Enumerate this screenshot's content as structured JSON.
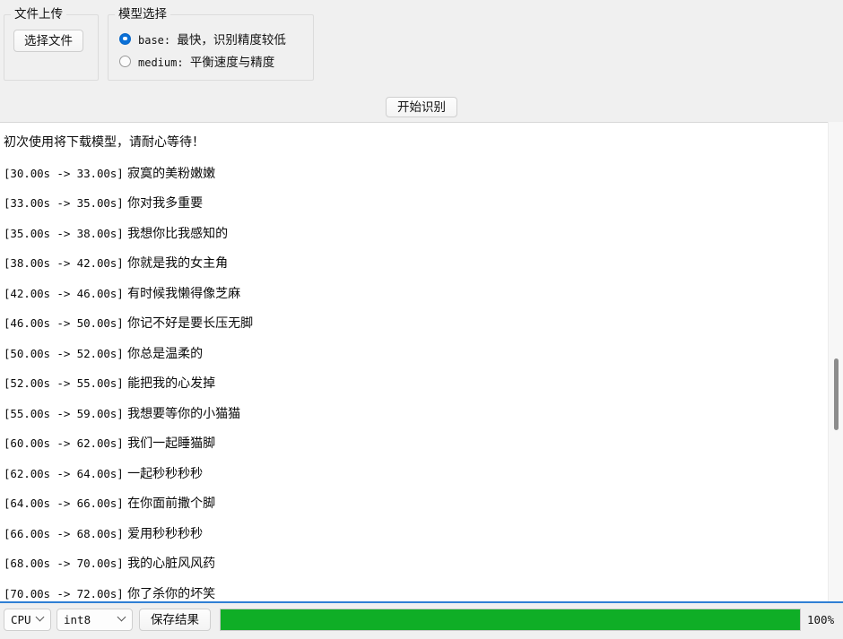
{
  "colors": {
    "window_bg": "#f0f0f0",
    "text_bg": "#ffffff",
    "accent_line": "#2f7fd4",
    "radio_selected": "#0a6fd6",
    "progress_fill": "#0fae26",
    "scroll_thumb": "#8c8c8c"
  },
  "upload_group": {
    "legend": "文件上传",
    "choose_file_label": "选择文件"
  },
  "model_group": {
    "legend": "模型选择",
    "options": [
      {
        "id": "base",
        "mono": "base:",
        "desc": "最快，识别精度较低",
        "selected": true
      },
      {
        "id": "medium",
        "mono": "medium:",
        "desc": "平衡速度与精度",
        "selected": false
      }
    ]
  },
  "actions": {
    "start_label": "开始识别",
    "save_label": "保存结果"
  },
  "transcript": {
    "notice": "初次使用将下载模型，请耐心等待！",
    "lines": [
      {
        "ts": "[30.00s -> 33.00s]",
        "text": "寂寞的美粉嫩嫩"
      },
      {
        "ts": "[33.00s -> 35.00s]",
        "text": "你对我多重要"
      },
      {
        "ts": "[35.00s -> 38.00s]",
        "text": "我想你比我感知的"
      },
      {
        "ts": "[38.00s -> 42.00s]",
        "text": "你就是我的女主角"
      },
      {
        "ts": "[42.00s -> 46.00s]",
        "text": "有时候我懒得像芝麻"
      },
      {
        "ts": "[46.00s -> 50.00s]",
        "text": "你记不好是要长压无脚"
      },
      {
        "ts": "[50.00s -> 52.00s]",
        "text": "你总是温柔的"
      },
      {
        "ts": "[52.00s -> 55.00s]",
        "text": "能把我的心发掉"
      },
      {
        "ts": "[55.00s -> 59.00s]",
        "text": "我想要等你的小猫猫"
      },
      {
        "ts": "[60.00s -> 62.00s]",
        "text": "我们一起睡猫脚"
      },
      {
        "ts": "[62.00s -> 64.00s]",
        "text": "一起秒秒秒秒"
      },
      {
        "ts": "[64.00s -> 66.00s]",
        "text": "在你面前撒个脚"
      },
      {
        "ts": "[66.00s -> 68.00s]",
        "text": "爱用秒秒秒秒"
      },
      {
        "ts": "[68.00s -> 70.00s]",
        "text": "我的心脏风风药"
      },
      {
        "ts": "[70.00s -> 72.00s]",
        "text": "你了杀你的坏笑"
      }
    ]
  },
  "status_bar": {
    "device_value": "CPU",
    "dtype_value": "int8",
    "progress_percent_label": "100%",
    "progress_value": 100
  }
}
